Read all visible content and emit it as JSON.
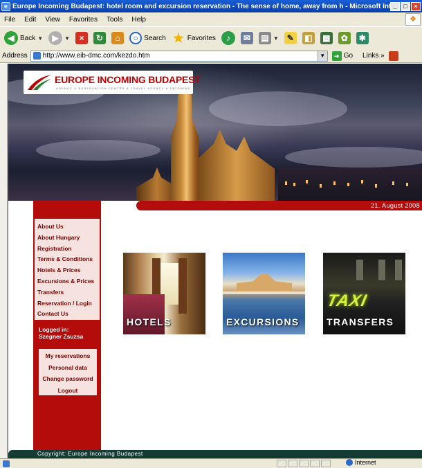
{
  "window": {
    "title": "Europe Incoming Budapest: hotel room and excursion reservation - The sense of home, away from h - Microsoft Internet ..."
  },
  "menu": [
    "File",
    "Edit",
    "View",
    "Favorites",
    "Tools",
    "Help"
  ],
  "toolbar": {
    "back_label": "Back",
    "search_label": "Search",
    "favorites_label": "Favorites"
  },
  "address": {
    "label": "Address",
    "url": "http://www.eib-dmc.com/kezdo.htm",
    "go_label": "Go",
    "links_label": "Links"
  },
  "site": {
    "logo_text": "EUROPE INCOMING BUDAPEST",
    "logo_sub": "AGENCY & RESERVATION CENTER & TRAVEL AGENCY & INCOMING",
    "date": "21. August 2008",
    "nav": [
      "About Us",
      "About Hungary",
      "Registration",
      "Terms & Conditions",
      "Hotels & Prices",
      "Excursions & Prices",
      "Transfers",
      "Reservation / Login",
      "Contact Us"
    ],
    "logged_in_label": "Logged in:",
    "user_name": "Szegner Zsuzsa",
    "user_menu": [
      "My reservations",
      "Personal data",
      "Change password",
      "Logout"
    ],
    "tiles": {
      "hotels": "HOTELS",
      "excursions": "EXCURSIONS",
      "transfers": "TRANSFERS",
      "taxi_sign": "TAXI"
    },
    "footer": "Copyright: Europe Incoming Budapest"
  },
  "status": {
    "zone": "Internet"
  },
  "colors": {
    "brand_red": "#b40b0b",
    "nav_bg": "#f6e3e0",
    "footer_green": "#143c34",
    "titlebar_blue": "#0a3ca8"
  }
}
